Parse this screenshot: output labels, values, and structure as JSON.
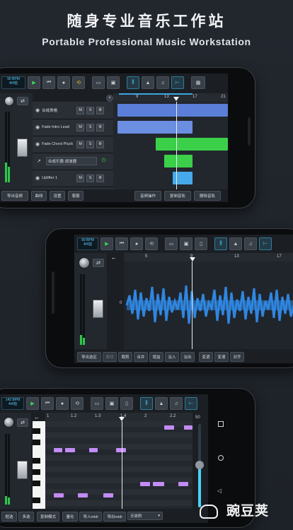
{
  "header": {
    "title": "随身专业音乐工作站",
    "subtitle": "Portable Professional Music Workstation"
  },
  "phone1": {
    "bpm": "90 BPM\n4/4拍",
    "ruler_marks": [
      "9",
      "13",
      "17",
      "21"
    ],
    "tracks": [
      {
        "name": "合成贵格"
      },
      {
        "name": "Fade Intro Lead"
      },
      {
        "name": "Fade Chord Pluck"
      },
      {
        "name": "合成乐器-滤波器"
      },
      {
        "name": "Uplifter 1"
      }
    ],
    "mute": "M",
    "solo": "S",
    "bottom_left": [
      "导出音频",
      "曲线",
      "设置",
      "客服"
    ],
    "bottom_right": [
      "音频操作",
      "复制音轨",
      "删除音轨"
    ]
  },
  "phone2": {
    "bpm": "90 BPM\n4/4拍",
    "ruler_marks": [
      "5",
      "9",
      "13",
      "17"
    ],
    "zero_label": "0",
    "bottom_buttons": [
      "导出选区",
      "剪切",
      "裁剪",
      "合并",
      "增益",
      "淡入",
      "淡出",
      "变调",
      "变速",
      "对齐"
    ]
  },
  "phone3": {
    "bpm": "142 BPM\n4/4拍",
    "ruler_marks": [
      "1",
      "1.2",
      "1.3",
      "1.4",
      "2",
      "2.2"
    ],
    "velocity": "50",
    "bottom_buttons": [
      "框选",
      "多选",
      "复制模式",
      "量化",
      "导入midi",
      "导出midi",
      "无吸附"
    ]
  },
  "watermark": "豌豆荚",
  "colors": {
    "accent": "#4ad2ff",
    "play": "#3ad65a",
    "loop": "#f0c020",
    "clip_blue": "#5b7fd8",
    "clip_green": "#3cd04a",
    "wave_blue": "#2f86e0",
    "note_purple": "#c38cf5"
  }
}
